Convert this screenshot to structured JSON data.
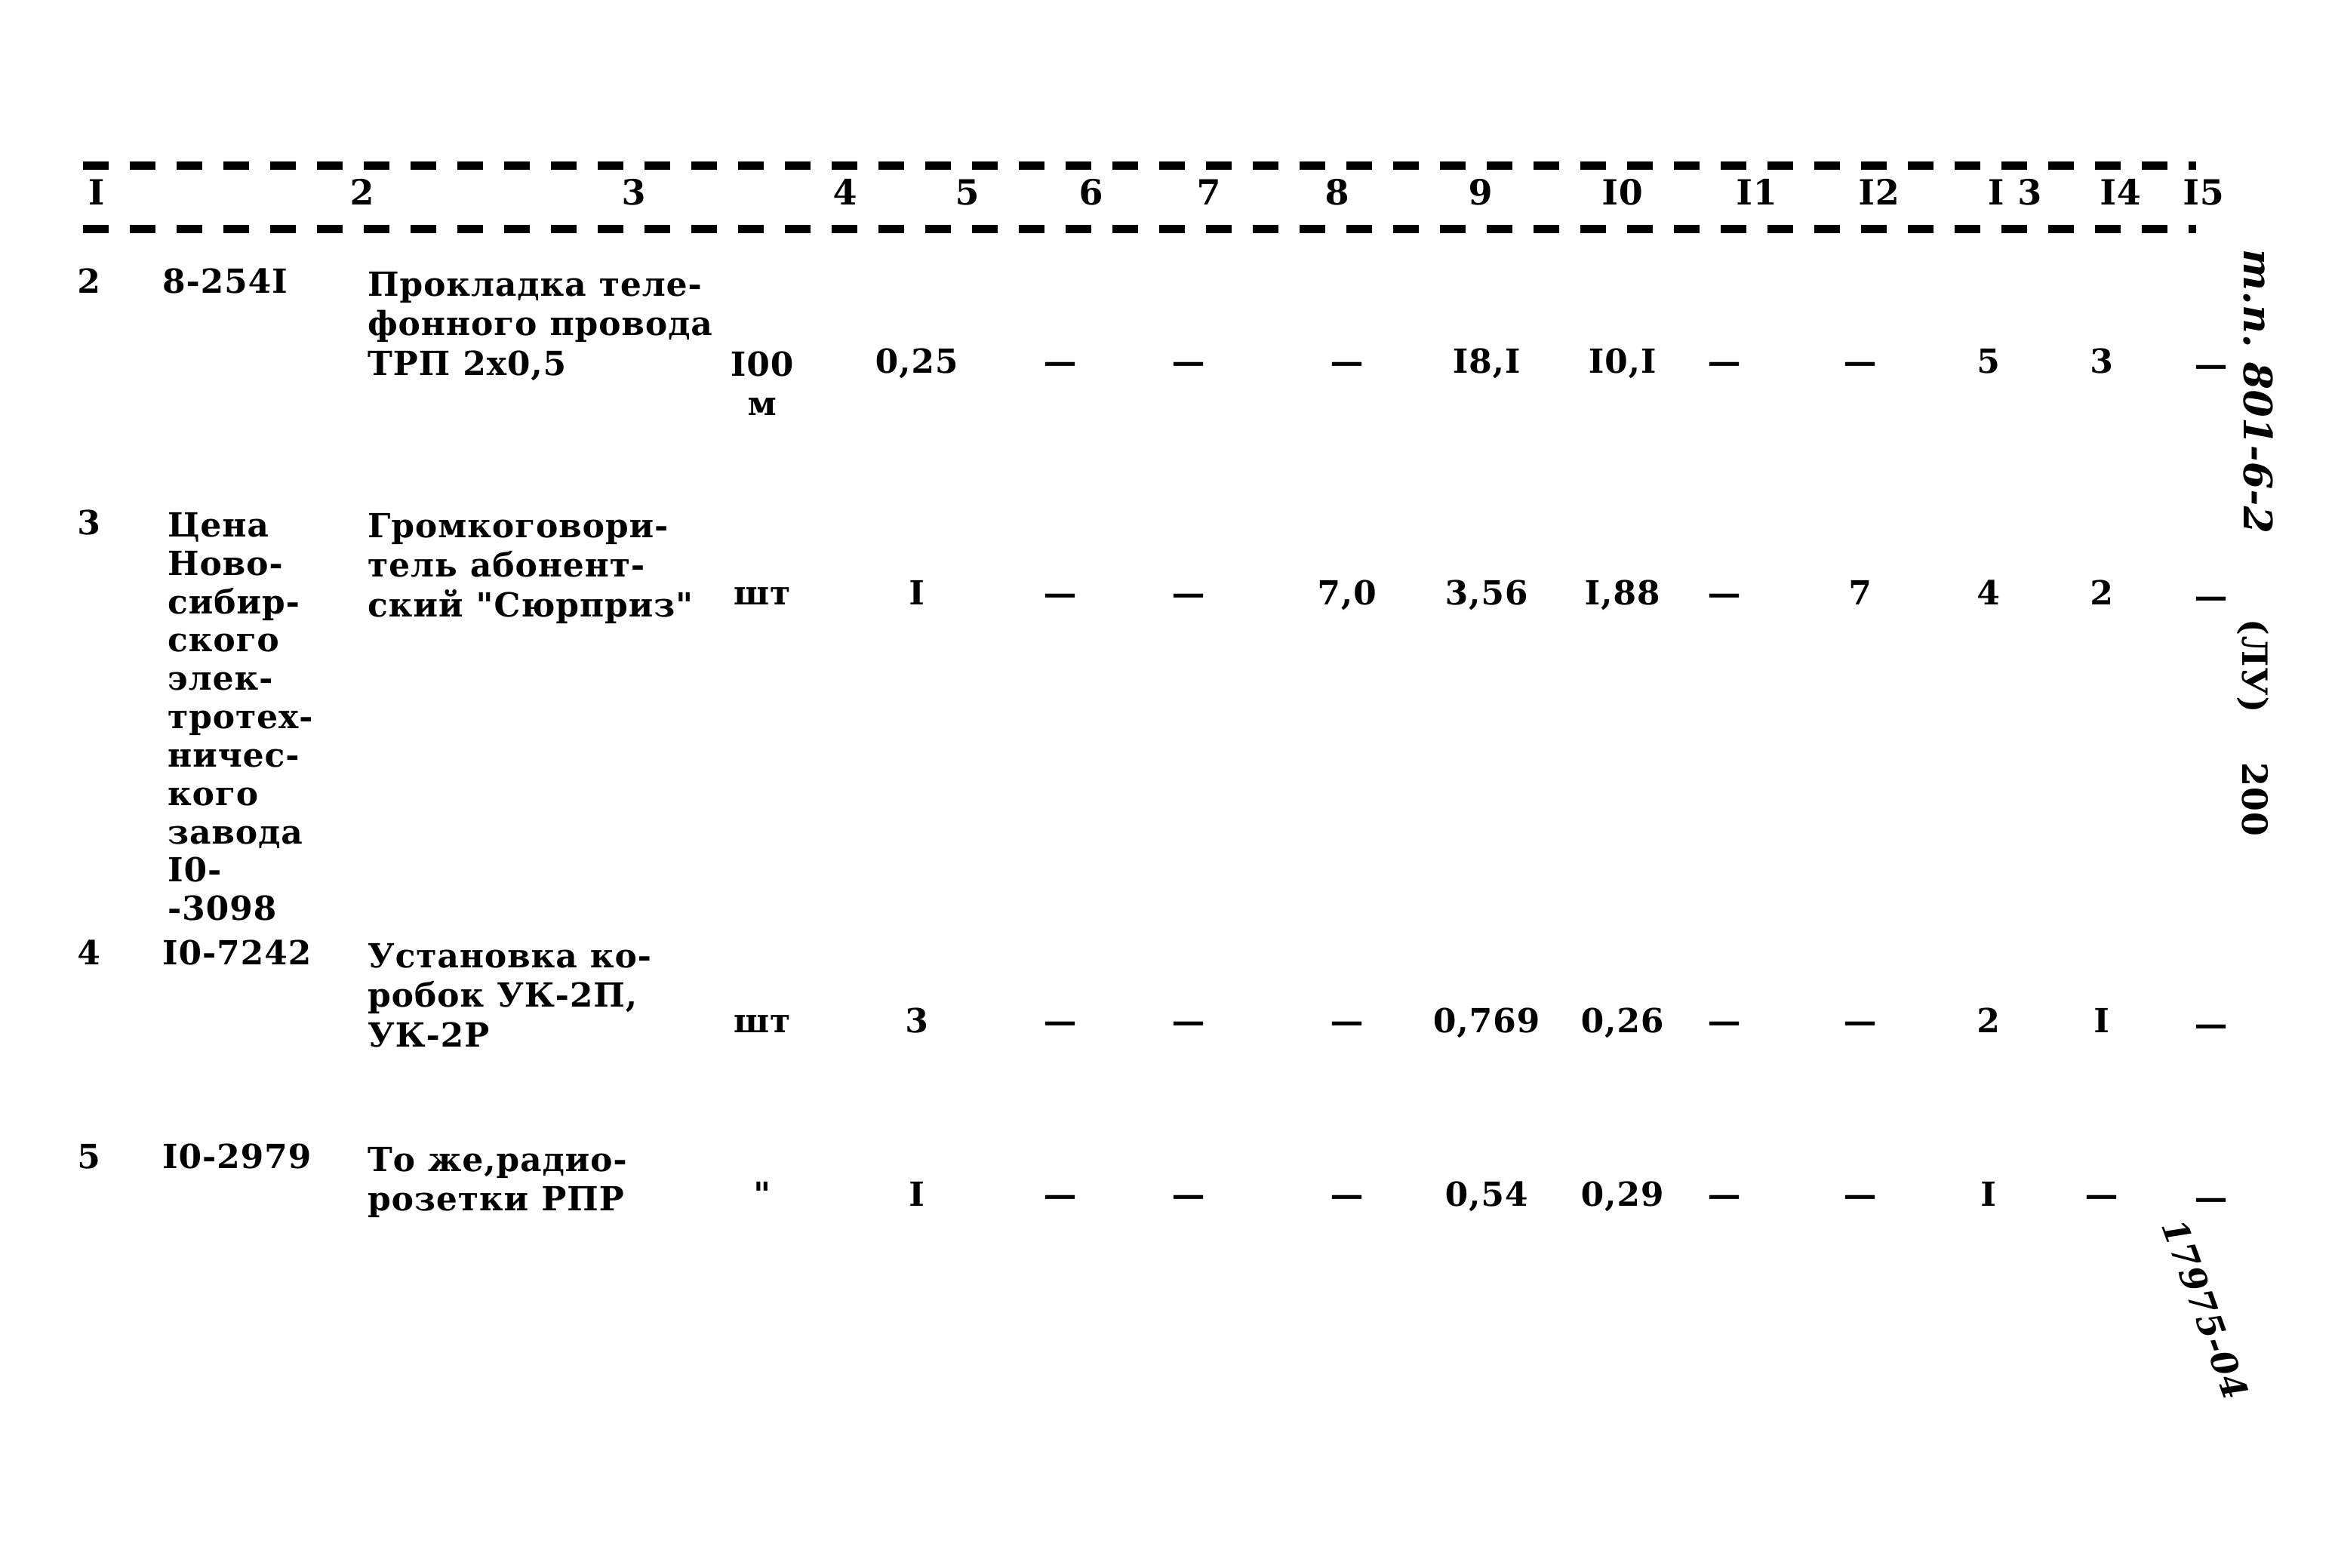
{
  "document": {
    "type": "scanned-table-page",
    "language": "ru"
  },
  "table": {
    "header": {
      "columns": [
        "I",
        "2",
        "3",
        "4",
        "5",
        "6",
        "7",
        "8",
        "9",
        "I0",
        "I1",
        "I2",
        "I 3",
        "I4",
        "I5"
      ]
    },
    "rows": [
      {
        "c1": "2",
        "c2": "8-254I",
        "c3": "Прокладка теле-\nфонного провода\nТРП 2х0,5",
        "c4": "I00\nм",
        "c5": "0,25",
        "c6": "—",
        "c7": "—",
        "c8": "—",
        "c9": "I8,I",
        "c10": "I0,I",
        "c11": "—",
        "c12": "—",
        "c13": "5",
        "c14": "3",
        "c15": "—"
      },
      {
        "c1": "3",
        "c2": "Цена\nНово-\nсибир-\nского\nэлек-\nтротех-\nничес-\nкого\nзавода\nI0-\n-3098",
        "c3": "Громкоговори-\nтель абонент-\nский \"Сюрприз\"",
        "c4": "шт",
        "c5": "I",
        "c6": "—",
        "c7": "—",
        "c8": "7,0",
        "c9": "3,56",
        "c10": "I,88",
        "c11": "—",
        "c12": "7",
        "c13": "4",
        "c14": "2",
        "c15": "—"
      },
      {
        "c1": "4",
        "c2": "I0-7242",
        "c3": "Установка ко-\nробок УК-2П,\n        УК-2Р",
        "c4": "шт",
        "c5": "3",
        "c6": "—",
        "c7": "—",
        "c8": "—",
        "c9": "0,769",
        "c10": "0,26",
        "c11": "—",
        "c12": "—",
        "c13": "2",
        "c14": "I",
        "c15": "—"
      },
      {
        "c1": "5",
        "c2": "I0-2979",
        "c3": "То же,радио-\nрозетки РПР",
        "c4": "\"",
        "c5": "I",
        "c6": "—",
        "c7": "—",
        "c8": "—",
        "c9": "0,54",
        "c10": "0,29",
        "c11": "—",
        "c12": "—",
        "c13": "I",
        "c14": "—",
        "c15": "—"
      }
    ]
  },
  "margin_notes": {
    "code": "т.п. 801-6-2",
    "lu": "(ЛУ)",
    "page_number": "200",
    "bottom_code": "17975-04"
  }
}
